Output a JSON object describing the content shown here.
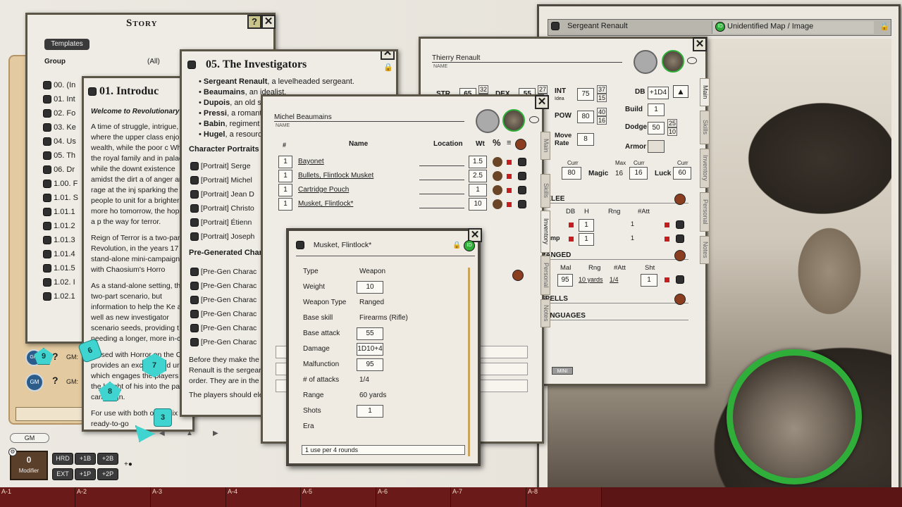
{
  "story": {
    "title": "Story",
    "templates_label": "Templates",
    "group_label": "Group",
    "group_value": "(All)",
    "items": [
      "00. (In",
      "01. Int",
      "02. Fo",
      "03. Ke",
      "04. Us",
      "05. Th",
      "06. Dr",
      "1.00. F",
      "1.01. S",
      "1.01.1",
      "1.01.2",
      "1.01.3",
      "1.01.4",
      "1.01.5",
      "1.02. I",
      "1.02.1"
    ]
  },
  "intro": {
    "title": "01. Introduc",
    "subtitle": "Welcome to Revolutionary",
    "paragraphs": [
      "A time of struggle, intrigue, where the upper class enjo of wealth, while the poor c Where the royal family and in palaces, while the downt existence amidst the dirt a of anger and rage at the inj sparking the people to unit for a brighter and more ho tomorrow, the hope of a p the way for terror.",
      "Reign of Terror is a two-part Revolution, in the years 17 stand-alone mini-campaign use with Chaosium's Horro",
      "As a stand-alone setting, th epic two-part scenario, but information to help the Ke as well as new investigator scenario seeds, providing t needing a longer, more in-c",
      "If used with Horror on the O provides an exciting and ur which engages the players For the height of his into the parent campaign.",
      "For use with both o are six ready-to-go"
    ]
  },
  "investigators": {
    "title": "05. The Investigators",
    "bullets": [
      [
        "Sergeant Renault",
        ", a levelheaded sergeant."
      ],
      [
        "Beaumains",
        ", an idealist."
      ],
      [
        "Dupois",
        ", an old s"
      ],
      [
        "Pressi",
        ", a romant"
      ],
      [
        "Babin",
        ", regiment"
      ],
      [
        "Hugel",
        ", a resourc"
      ]
    ],
    "portraits_heading": "Character Portraits",
    "portraits": [
      "[Portrait] Serge",
      "[Portrait] Michel",
      "[Portrait] Jean D",
      "[Portrait] Christo",
      "[Portrait] Étienn",
      "[Portrait] Joseph"
    ],
    "pregen_heading": "Pre-Generated Char",
    "pregens": [
      "[Pre-Gen Charac",
      "[Pre-Gen Charac",
      "[Pre-Gen Charac",
      "[Pre-Gen Charac",
      "[Pre-Gen Charac",
      "[Pre-Gen Charac"
    ],
    "footer_text": "Before they make the Renault is the sergear order. They are in the",
    "footer_text2": "The players should ele"
  },
  "michel": {
    "name": "Michel Beaumains",
    "name_label": "NAME",
    "columns": {
      "num": "#",
      "name": "Name",
      "location": "Location",
      "wt": "Wt"
    },
    "items": [
      {
        "qty": "1",
        "name": "Bayonet",
        "wt": "1.5"
      },
      {
        "qty": "1",
        "name": "Bullets, Flintlock Musket",
        "wt": "2.5"
      },
      {
        "qty": "1",
        "name": "Cartridge Pouch",
        "wt": "1"
      },
      {
        "qty": "1",
        "name": "Musket, Flintlock*",
        "wt": "10"
      }
    ],
    "tabs": [
      "Main",
      "Skills",
      "Inventory",
      "Personal",
      "Notes"
    ]
  },
  "thierry": {
    "name": "Thierry Renault",
    "name_label": "NAME",
    "str_label": "STR",
    "str": "65",
    "str_half": "32",
    "str_fifth": "13",
    "dex_label": "DEX",
    "dex": "55",
    "dex_half": "27",
    "dex_fifth": "11",
    "int_label": "INT",
    "int_sub": "Idea",
    "int": "75",
    "int_half": "37",
    "int_fifth": "15",
    "pow_label": "POW",
    "pow": "80",
    "pow_half": "40",
    "pow_fifth": "16",
    "move_label": "Move Rate",
    "move": "8",
    "db_label": "DB",
    "db": "+1D4",
    "build_label": "Build",
    "build": "1",
    "dodge_label": "Dodge",
    "dodge": "50",
    "dodge_half": "25",
    "dodge_fifth": "10",
    "armor_label": "Armor",
    "curr_label": "Curr",
    "max_label": "Max",
    "hp_curr": "80",
    "magic_label": "Magic",
    "magic_max": "16",
    "magic_curr": "16",
    "luck_label": "Luck",
    "luck_curr": "60",
    "melee_label": "MELEE",
    "melee_cols": [
      "DB",
      "H",
      "Rng",
      "#Att"
    ],
    "melee_rows": [
      {
        "name": "",
        "h": "1",
        "att": "1"
      },
      {
        "name": "mp",
        "h": "1",
        "att": "1"
      }
    ],
    "ranged_label": "RANGED",
    "ranged_cols": [
      "Mal",
      "Rng",
      "#Att",
      "Sht"
    ],
    "ranged_row": {
      "mal": "95",
      "rng": "10 yards",
      "att": "1/4",
      "sht": "1"
    },
    "spells_label": "SPELLS",
    "languages_label": "LANGUAGES",
    "mini_label": "MINI",
    "tabs": [
      "Main",
      "Skills",
      "Inventory",
      "Personal",
      "Notes"
    ]
  },
  "image_window": {
    "tab1": "Sergeant Renault",
    "tab2": "Unidentified Map / Image"
  },
  "musket": {
    "title": "Musket, Flintlock*",
    "fields": [
      {
        "label": "Type",
        "value": "Weapon",
        "boxed": false
      },
      {
        "label": "Weight",
        "value": "10",
        "boxed": true
      },
      {
        "label": "Weapon Type",
        "value": "Ranged",
        "boxed": false
      },
      {
        "label": "Base skill",
        "value": "Firearms (Rifle)",
        "boxed": false
      },
      {
        "label": "Base attack",
        "value": "55",
        "boxed": true
      },
      {
        "label": "Damage",
        "value": "1D10+4",
        "boxed": true
      },
      {
        "label": "Malfunction",
        "value": "95",
        "boxed": true
      },
      {
        "label": "# of attacks",
        "value": "1/4",
        "boxed": false
      },
      {
        "label": "Range",
        "value": "60 yards",
        "boxed": false
      },
      {
        "label": "Shots",
        "value": "1",
        "boxed": true
      },
      {
        "label": "Era",
        "value": "",
        "boxed": false
      }
    ],
    "era_value": "1 use per 4 rounds"
  },
  "chat": {
    "gm1": "GM:",
    "gm2": "GM:",
    "gm_label": "GM"
  },
  "modifier": {
    "value": "0",
    "label": "Modifier",
    "buttons": [
      "HRD",
      "+1B",
      "+2B",
      "EXT",
      "+1P",
      "+2P"
    ]
  },
  "dice": [
    "6",
    "9",
    "7",
    "3",
    "8"
  ],
  "hotbar": [
    "A-1",
    "A-2",
    "A-3",
    "A-4",
    "A-5",
    "A-6",
    "A-7",
    "A-8"
  ],
  "colors": {
    "accent_green": "#2fae3a",
    "die": "#3fd4d0",
    "hotbar": "#6b1a1a",
    "close_bg": "#e6e3d6"
  },
  "icons": [
    "close-icon",
    "help-icon",
    "lock-icon",
    "id-icon",
    "chat-icon",
    "edit-icon",
    "weapon-icon",
    "bag-icon",
    "chevron-left-icon",
    "chevron-up-icon",
    "chevron-right-icon"
  ]
}
